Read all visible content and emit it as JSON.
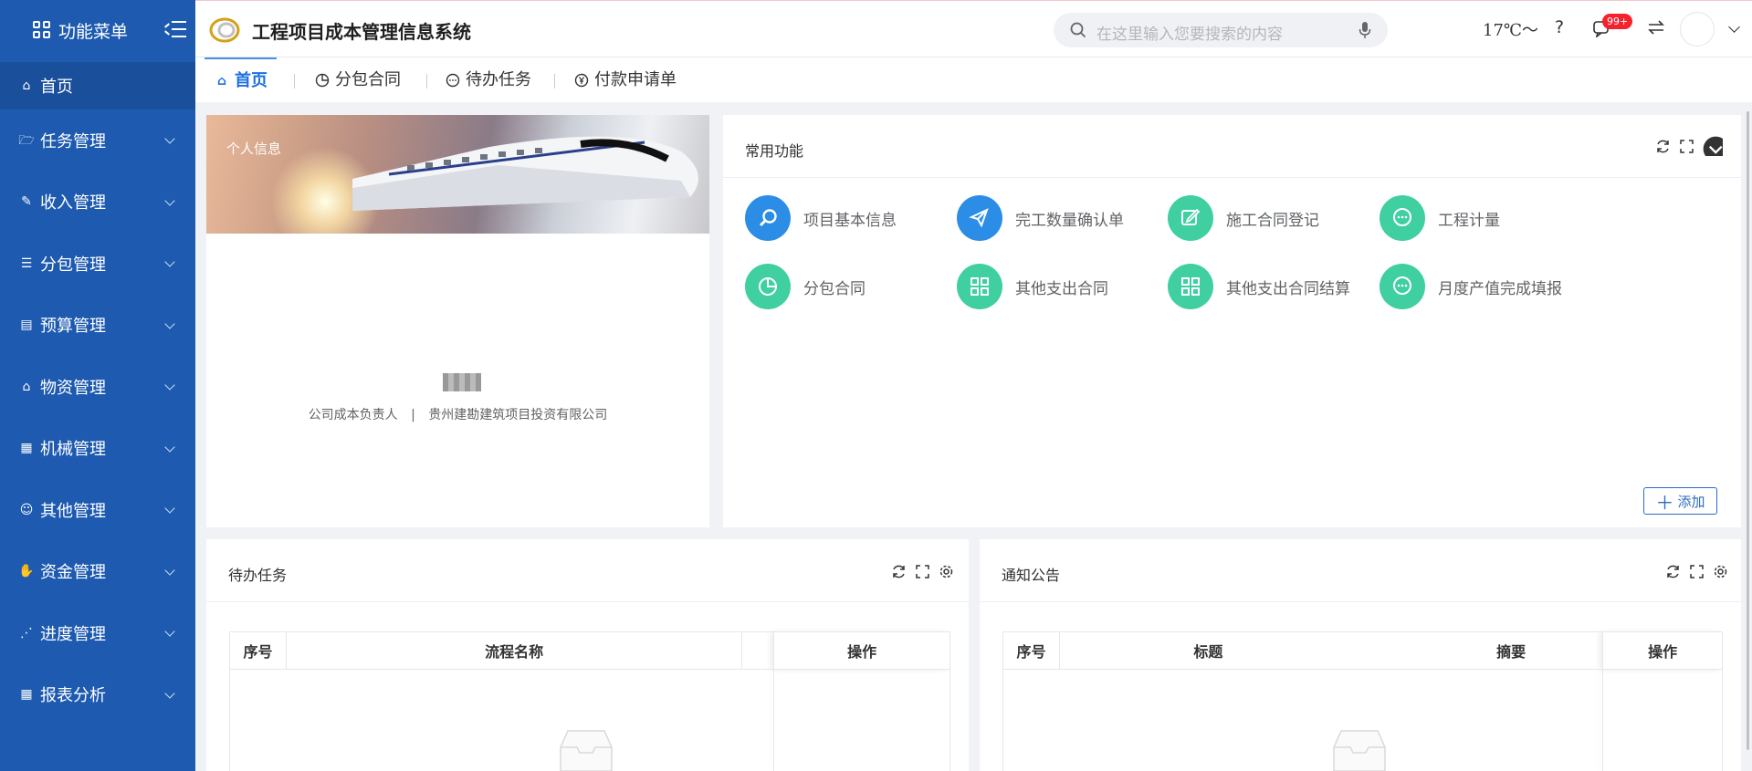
{
  "sidebar": {
    "title": "功能菜单",
    "active": {
      "label": "首页",
      "icon": "home-icon"
    },
    "items": [
      {
        "label": "任务管理",
        "icon": "folder-icon"
      },
      {
        "label": "收入管理",
        "icon": "pin-icon"
      },
      {
        "label": "分包管理",
        "icon": "database-icon"
      },
      {
        "label": "预算管理",
        "icon": "document-icon"
      },
      {
        "label": "物资管理",
        "icon": "bank-icon"
      },
      {
        "label": "机械管理",
        "icon": "table-icon"
      },
      {
        "label": "其他管理",
        "icon": "user-group-icon"
      },
      {
        "label": "资金管理",
        "icon": "hand-coin-icon"
      },
      {
        "label": "进度管理",
        "icon": "chart-line-icon"
      },
      {
        "label": "报表分析",
        "icon": "grid-icon"
      }
    ]
  },
  "header": {
    "system_title": "工程项目成本管理信息系统",
    "search_placeholder": "在这里输入您要搜索的内容",
    "weather": "17℃～",
    "help": "?",
    "badge": "99+"
  },
  "tabs": [
    {
      "label": "首页",
      "icon": "home-icon",
      "active": true
    },
    {
      "label": "分包合同",
      "icon": "pie-icon",
      "active": false
    },
    {
      "label": "待办任务",
      "icon": "chat-icon",
      "active": false
    },
    {
      "label": "付款申请单",
      "icon": "yen-icon",
      "active": false
    }
  ],
  "profile": {
    "banner_label": "个人信息",
    "position": "公司成本负责人",
    "separator": "|",
    "company": "贵州建勘建筑项目投资有限公司"
  },
  "common_functions": {
    "title": "常用功能",
    "add_label": "添加",
    "items": [
      {
        "label": "项目基本信息",
        "icon": "search-icon",
        "color": "#2b8de6"
      },
      {
        "label": "完工数量确认单",
        "icon": "send-icon",
        "color": "#2b8de6"
      },
      {
        "label": "施工合同登记",
        "icon": "edit-icon",
        "color": "#3fcfa0"
      },
      {
        "label": "工程计量",
        "icon": "chat-icon",
        "color": "#3fcfa0"
      },
      {
        "label": "分包合同",
        "icon": "pie-icon",
        "color": "#3fcfa0"
      },
      {
        "label": "其他支出合同",
        "icon": "grid-icon",
        "color": "#3fcfa0"
      },
      {
        "label": "其他支出合同结算",
        "icon": "grid-icon",
        "color": "#3fcfa0"
      },
      {
        "label": "月度产值完成填报",
        "icon": "chat-icon",
        "color": "#3fcfa0"
      }
    ]
  },
  "todo": {
    "title": "待办任务",
    "columns": [
      "序号",
      "流程名称",
      "操作"
    ]
  },
  "notice": {
    "title": "通知公告",
    "columns": [
      "序号",
      "标题",
      "摘要",
      "操作"
    ]
  }
}
